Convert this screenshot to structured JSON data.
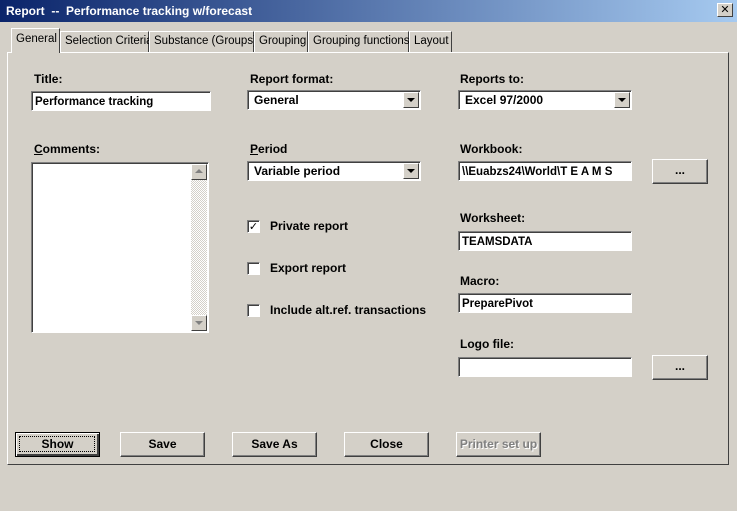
{
  "window": {
    "title": "Report  --  Performance tracking w/forecast",
    "close_glyph": "✕"
  },
  "tabs": [
    {
      "label": "General",
      "active": true
    },
    {
      "label": "Selection Criteria",
      "active": false
    },
    {
      "label": "Substance (Groups)",
      "active": false
    },
    {
      "label": "Grouping",
      "active": false
    },
    {
      "label": "Grouping functions",
      "active": false
    },
    {
      "label": "Layout",
      "active": false
    }
  ],
  "general": {
    "title_label": "Title:",
    "title_value": "Performance tracking",
    "comments_label_first": "C",
    "comments_label_rest": "omments:",
    "comments_value": "",
    "report_format_label": "Report format:",
    "report_format_value": "General",
    "period_label_first": "P",
    "period_label_rest": "eriod",
    "period_value": "Variable period",
    "private_report_label": "Private report",
    "private_report_checked": true,
    "export_report_label": "Export report",
    "export_report_checked": false,
    "include_alt_label": "Include alt.ref. transactions",
    "include_alt_checked": false,
    "reports_to_label": "Reports to:",
    "reports_to_value": "Excel 97/2000",
    "workbook_label": "Workbook:",
    "workbook_value": "\\\\Euabzs24\\World\\T E A M S",
    "worksheet_label": "Worksheet:",
    "worksheet_value": "TEAMSDATA",
    "macro_label": "Macro:",
    "macro_value": "PreparePivot",
    "logo_file_label": "Logo file:",
    "logo_file_value": "",
    "browse_label": "...",
    "check_glyph": "✓"
  },
  "buttons": {
    "show": "Show",
    "save": "Save",
    "save_as": "Save As",
    "close": "Close",
    "printer_setup": "Printer set up"
  }
}
